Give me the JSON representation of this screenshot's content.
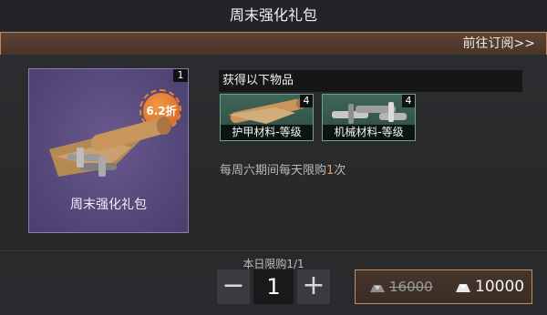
{
  "title": "周末强化礼包",
  "subscribe_link": "前往订阅>>",
  "pack": {
    "name": "周末强化礼包",
    "count": "1",
    "discount": "6.2折"
  },
  "rewards_title": "获得以下物品",
  "items": [
    {
      "name": "护甲材料-等级",
      "count": "4",
      "icon": "armor-material-icon"
    },
    {
      "name": "机械材料-等级",
      "count": "4",
      "icon": "mechanical-material-icon"
    }
  ],
  "limit": {
    "prefix": "每周六期间每天限购",
    "count": "1",
    "suffix": "次"
  },
  "daily_limit": "本日限购1/1",
  "stepper": {
    "value": "1",
    "minus": "−",
    "plus": "+"
  },
  "price": {
    "old": "16000",
    "new": "10000"
  }
}
